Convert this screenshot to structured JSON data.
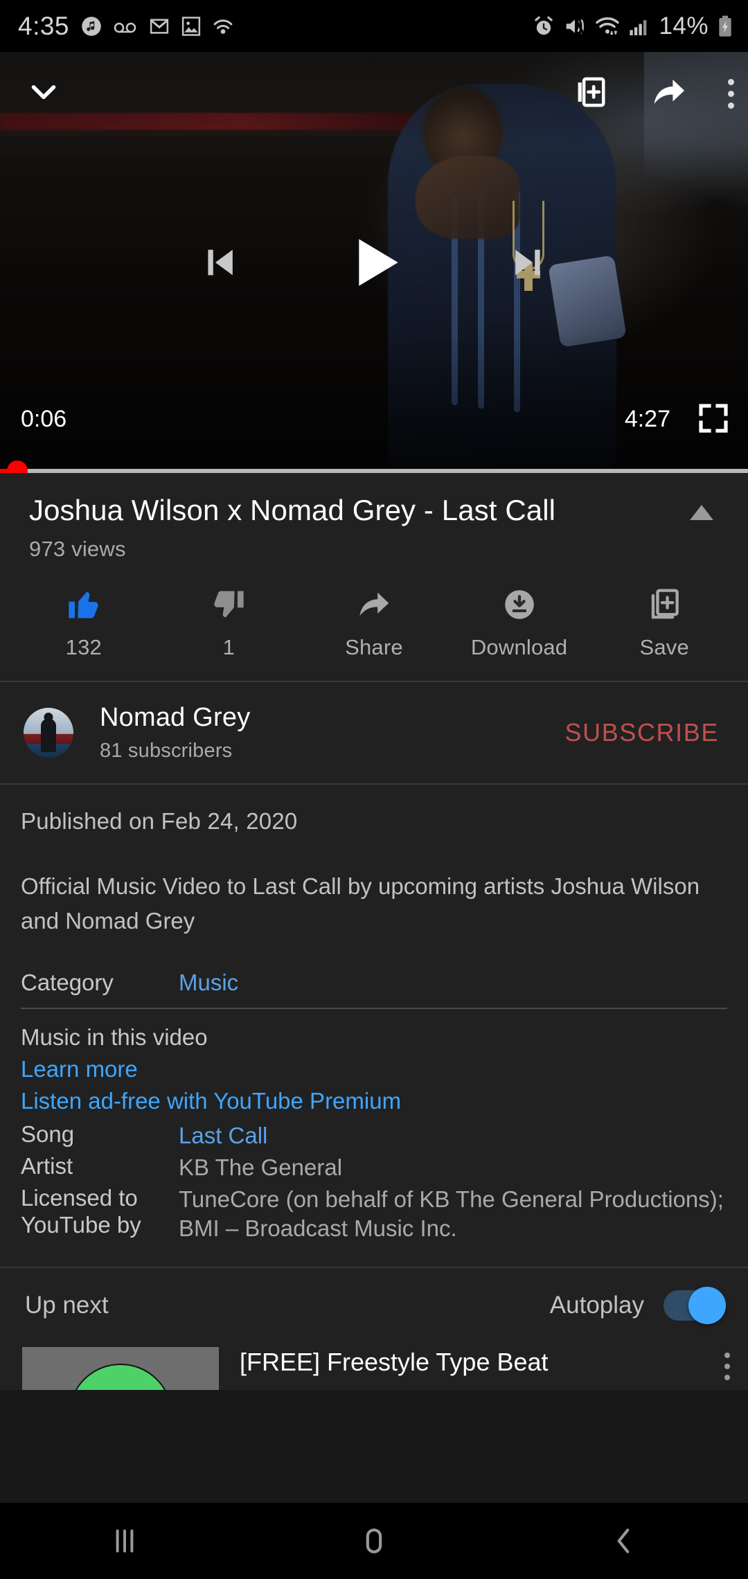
{
  "status_bar": {
    "time": "4:35",
    "battery_percent": "14%",
    "left_icons": [
      "music-note-icon",
      "voicemail-icon",
      "gmail-icon",
      "screenshot-image-icon",
      "android-auto-icon"
    ],
    "right_icons": [
      "alarm-icon",
      "vibrate-mute-icon",
      "wifi-icon",
      "cellular-signal-icon",
      "battery-charging-icon"
    ]
  },
  "player": {
    "collapse_icon": "chevron-down-icon",
    "add_to_queue_icon": "add-to-queue-icon",
    "cast_share_icon": "share-arrow-icon",
    "overflow_icon": "more-vertical-icon",
    "previous_icon": "skip-previous-icon",
    "play_icon": "play-icon",
    "next_icon": "skip-next-icon",
    "current_time": "0:06",
    "duration": "4:27",
    "fullscreen_icon": "fullscreen-icon",
    "progress_percent": 2.3,
    "scrubber_color": "#ff0000"
  },
  "video": {
    "title": "Joshua Wilson x Nomad Grey - Last Call",
    "views": "973 views",
    "collapse_caret_icon": "caret-up-icon"
  },
  "actions": [
    {
      "icon": "thumbs-up-icon",
      "label": "132",
      "name": "like-button",
      "active": true
    },
    {
      "icon": "thumbs-down-icon",
      "label": "1",
      "name": "dislike-button",
      "active": false
    },
    {
      "icon": "share-arrow-icon",
      "label": "Share",
      "name": "share-button",
      "active": false
    },
    {
      "icon": "download-icon",
      "label": "Download",
      "name": "download-button",
      "active": false
    },
    {
      "icon": "save-to-playlist-icon",
      "label": "Save",
      "name": "save-button",
      "active": false
    }
  ],
  "channel": {
    "name": "Nomad Grey",
    "subscribers": "81 subscribers",
    "subscribe_label": "SUBSCRIBE",
    "subscribe_color": "#c0504d",
    "avatar_icon": "channel-avatar"
  },
  "description": {
    "published": "Published on Feb 24, 2020",
    "body": "Official Music Video to Last Call by upcoming artists Joshua Wilson and Nomad Grey",
    "category_key": "Category",
    "category_value": "Music"
  },
  "music_section": {
    "header": "Music in this video",
    "learn_more": "Learn more",
    "premium": "Listen ad-free with YouTube Premium",
    "rows": [
      {
        "key": "Song",
        "value": "Last Call",
        "link": true
      },
      {
        "key": "Artist",
        "value": "KB The General",
        "link": false
      },
      {
        "key": "Licensed to YouTube by",
        "value": "TuneCore (on behalf of KB The General Productions); BMI – Broadcast Music Inc.",
        "link": false
      }
    ]
  },
  "up_next": {
    "label": "Up next",
    "autoplay_label": "Autoplay",
    "autoplay_on": true,
    "accent": "#3ea6ff",
    "suggestion": {
      "title": "[FREE] Freestyle Type Beat",
      "menu_icon": "more-vertical-icon"
    }
  },
  "nav_bar": {
    "recents_icon": "recents-icon",
    "home_icon": "home-icon",
    "back_icon": "back-icon"
  }
}
